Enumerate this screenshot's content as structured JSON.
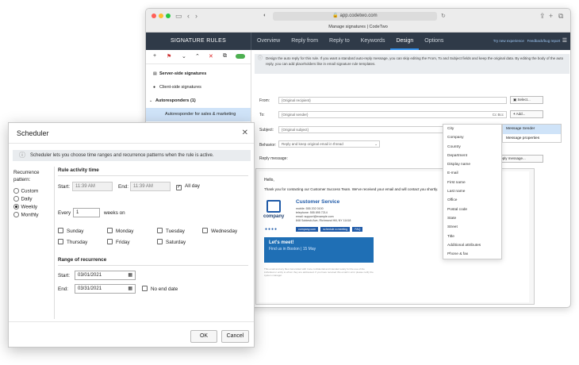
{
  "browser": {
    "url": "app.codetwo.com",
    "tab_title": "Manage signatures | CodeTwo"
  },
  "app": {
    "sidebar_title": "SIGNATURE RULES",
    "tabs": [
      "Overview",
      "Reply from",
      "Reply to",
      "Keywords",
      "Design",
      "Options"
    ],
    "active_tab": "Design",
    "links": {
      "try_new": "Try new experience",
      "feedback": "Feedback/bug report"
    }
  },
  "sidebar": {
    "items": [
      "Server-side signatures",
      "Client-side signatures",
      "Autoresponders (1)",
      "Autoresponder for sales & marketing"
    ]
  },
  "design": {
    "info": "Design the auto reply for this rule. If you want a standard auto-reply message, you can skip editing the From, To and Subject fields and keep the original data. By editing the body of the auto reply, you can add placeholders like in email signature rule templates.",
    "from_label": "From:",
    "from_value": "{Original recipient}",
    "from_button": "Select...",
    "to_label": "To:",
    "to_value": "{Original sender}",
    "to_ccbcc": "Cc  Bcc",
    "to_button": "Add...",
    "subject_label": "Subject:",
    "subject_value": "{Original subject}",
    "subject_button": "Add...",
    "behavior_label": "Behavior:",
    "behavior_value": "Reply and keep original email in thread",
    "reply_label": "Reply message:",
    "reply_button": "Reply message...",
    "body_hello": "Hello,",
    "body_text": "Thank you for contacting our Customer Success Team. We've received your email and will contact you shortly.",
    "sig_name": "Customer Service",
    "sig_company": "company",
    "sig_lines": [
      "mobile: 555 202 0100",
      "telephone: 555 895 7214",
      "email: support@example.com",
      "848 Sobieski Ave, Richmond Hill, NY 11418"
    ],
    "sig_buttons": [
      "company.com",
      "schedule a meeting",
      "FAQ"
    ],
    "banner_title": "Let's meet!",
    "banner_sub": "Find us in Boston | 15 May",
    "disclaimer": "This email and any files transmitted with it are confidential and intended solely for the use of the individual or entity to whom they are addressed. If you have received this email in error please notify the system manager."
  },
  "dropdown": {
    "items": [
      "City",
      "Company",
      "Country",
      "Department",
      "Display name",
      "E-mail",
      "First name",
      "Last name",
      "Office",
      "Postal code",
      "State",
      "Street",
      "Title",
      "Additional attributes",
      "Phone & fax"
    ],
    "submenu": [
      "Message Sender",
      "Message properties"
    ]
  },
  "scheduler": {
    "title": "Scheduler",
    "info": "Scheduler lets you choose time ranges and recurrence patterns when the rule is active.",
    "recurrence_label": "Recurrence pattern:",
    "patterns": [
      "Custom",
      "Daily",
      "Weekly",
      "Monthly"
    ],
    "selected_pattern": "Weekly",
    "activity_title": "Rule activity time",
    "start_label": "Start:",
    "start_time": "11:39 AM",
    "end_label": "End:",
    "end_time": "11:39 AM",
    "all_day": "All day",
    "every_label": "Every",
    "every_value": "1",
    "weeks_on": "weeks on",
    "days": [
      "Sunday",
      "Monday",
      "Tuesday",
      "Wednesday",
      "Thursday",
      "Friday",
      "Saturday"
    ],
    "range_title": "Range of recurrence",
    "range_start_label": "Start:",
    "range_start": "03/01/2021",
    "range_end_label": "End:",
    "range_end": "03/31/2021",
    "no_end": "No end date",
    "ok": "OK",
    "cancel": "Cancel"
  },
  "colors": {
    "topbar": "#2f3a48",
    "accent": "#2e8be6",
    "selected": "#cfe3f8",
    "banner": "#1f6fb5"
  }
}
